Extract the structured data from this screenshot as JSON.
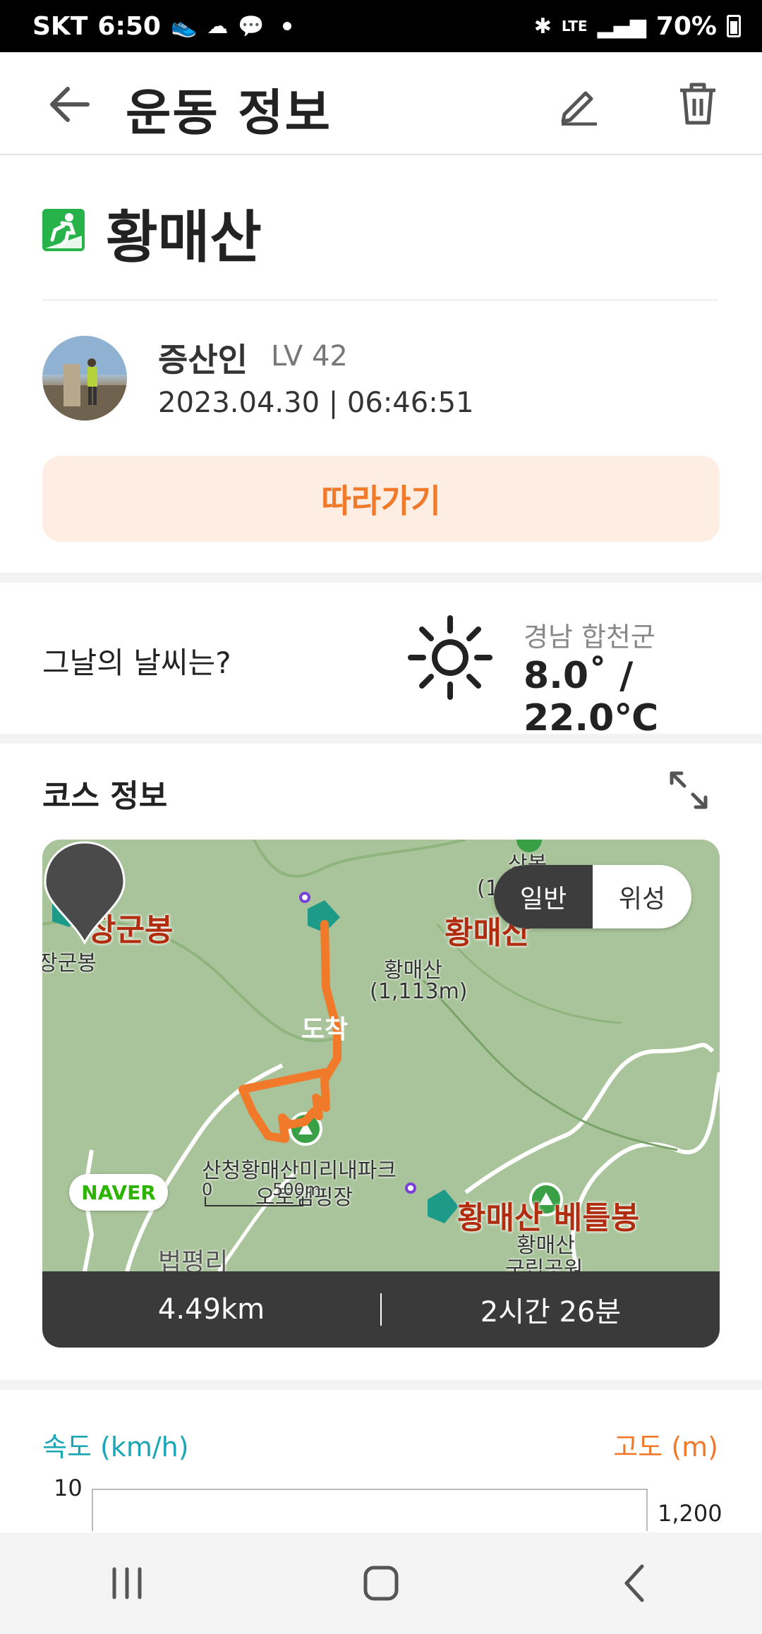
{
  "status_bar": {
    "carrier": "SKT",
    "time": "6:50",
    "network": "LTE",
    "battery": "70%"
  },
  "app_bar": {
    "title": "운동 정보",
    "icons": [
      "back-arrow-icon",
      "pencil-icon",
      "trash-icon"
    ]
  },
  "activity": {
    "icon": "hiking-icon",
    "title": "황매산",
    "user": {
      "name": "증산인",
      "level": "LV 42",
      "datetime": "2023.04.30 | 06:46:51"
    },
    "follow_label": "따라가기"
  },
  "weather": {
    "question": "그날의 날씨는?",
    "icon": "sun-icon",
    "location": "경남 합천군",
    "temperature": "8.0˚ / 22.0℃"
  },
  "course": {
    "title": "코스 정보",
    "map": {
      "toggle": {
        "normal": "일반",
        "satellite": "위성",
        "selected": "normal"
      },
      "arrive_label": "도착",
      "provider": "NAVER",
      "scale_zero": "0",
      "scale_value": "500m",
      "places": {
        "janggunbong": "장군봉",
        "janggunbong_sub": "장군봉",
        "hwangmaesan": "황매산",
        "hwangmaesan_sub1": "황매산",
        "hwangmaesan_sub2": "(1,113m)",
        "sangbong": "상봉",
        "sangbong_sub": "(1",
        "camping1": "산청황매산미리내파크",
        "camping2": "오토캠핑장",
        "betteulbong": "황매산 베틀봉",
        "park1": "황매산",
        "park2": "군립공원",
        "village": "법평리"
      },
      "route_color": "#f07a2a"
    },
    "distance": "4.49km",
    "duration": "2시간 26분"
  },
  "chart": {
    "speed_label": "속도 (km/h)",
    "altitude_label": "고도 (m)",
    "speed_top_tick": "10",
    "altitude_top_tick": "1,200"
  },
  "nav_bar": {
    "icons": [
      "recent-apps-icon",
      "home-icon",
      "back-icon"
    ]
  }
}
